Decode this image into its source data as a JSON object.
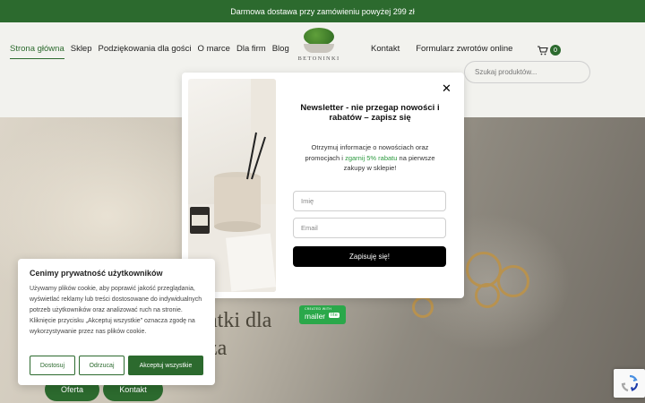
{
  "topbar": {
    "text": "Darmowa dostawa przy zamówieniu powyżej 299 zł"
  },
  "nav": {
    "left": [
      "Strona główna",
      "Sklep",
      "Podziękowania dla gości",
      "O marce",
      "Dla firm",
      "Blog"
    ],
    "right": [
      "Kontakt",
      "Formularz zwrotów online"
    ]
  },
  "logo": {
    "name": "BETONINKI"
  },
  "cart": {
    "count": "0",
    "icon": "cart-icon"
  },
  "search": {
    "placeholder": "Szukaj produktów..."
  },
  "hero": {
    "title_line1": "atki dla",
    "title_line2": "za",
    "buttons": [
      "Oferta",
      "Kontakt"
    ]
  },
  "newsletter": {
    "close": "✕",
    "title": "Newsletter - nie przegap nowości i rabatów – zapisz się",
    "text_before": "Otrzymuj informacje o nowościach oraz promocjach i ",
    "text_highlight": "zgarnij 5% rabatu",
    "text_after": " na pierwsze zakupy w sklepie!",
    "name_placeholder": "Imię",
    "email_placeholder": "Email",
    "submit": "Zapisuję się!"
  },
  "mailer_badge": {
    "small": "CREATED WITH",
    "big": "mailer",
    "lite": "lite"
  },
  "cookie": {
    "title": "Cenimy prywatność użytkowników",
    "text": "Używamy plików cookie, aby poprawić jakość przeglądania, wyświetlać reklamy lub treści dostosowane do indywidualnych potrzeb użytkowników oraz analizować ruch na stronie. Kliknięcie przycisku „Akceptuj wszystkie” oznacza zgodę na wykorzystywanie przez nas plików cookie.",
    "buttons": [
      "Dostosuj",
      "Odrzucaj",
      "Akceptuj wszystkie"
    ]
  },
  "colors": {
    "brand_green": "#2c6a2e",
    "highlight_green": "#2c9a3f"
  }
}
